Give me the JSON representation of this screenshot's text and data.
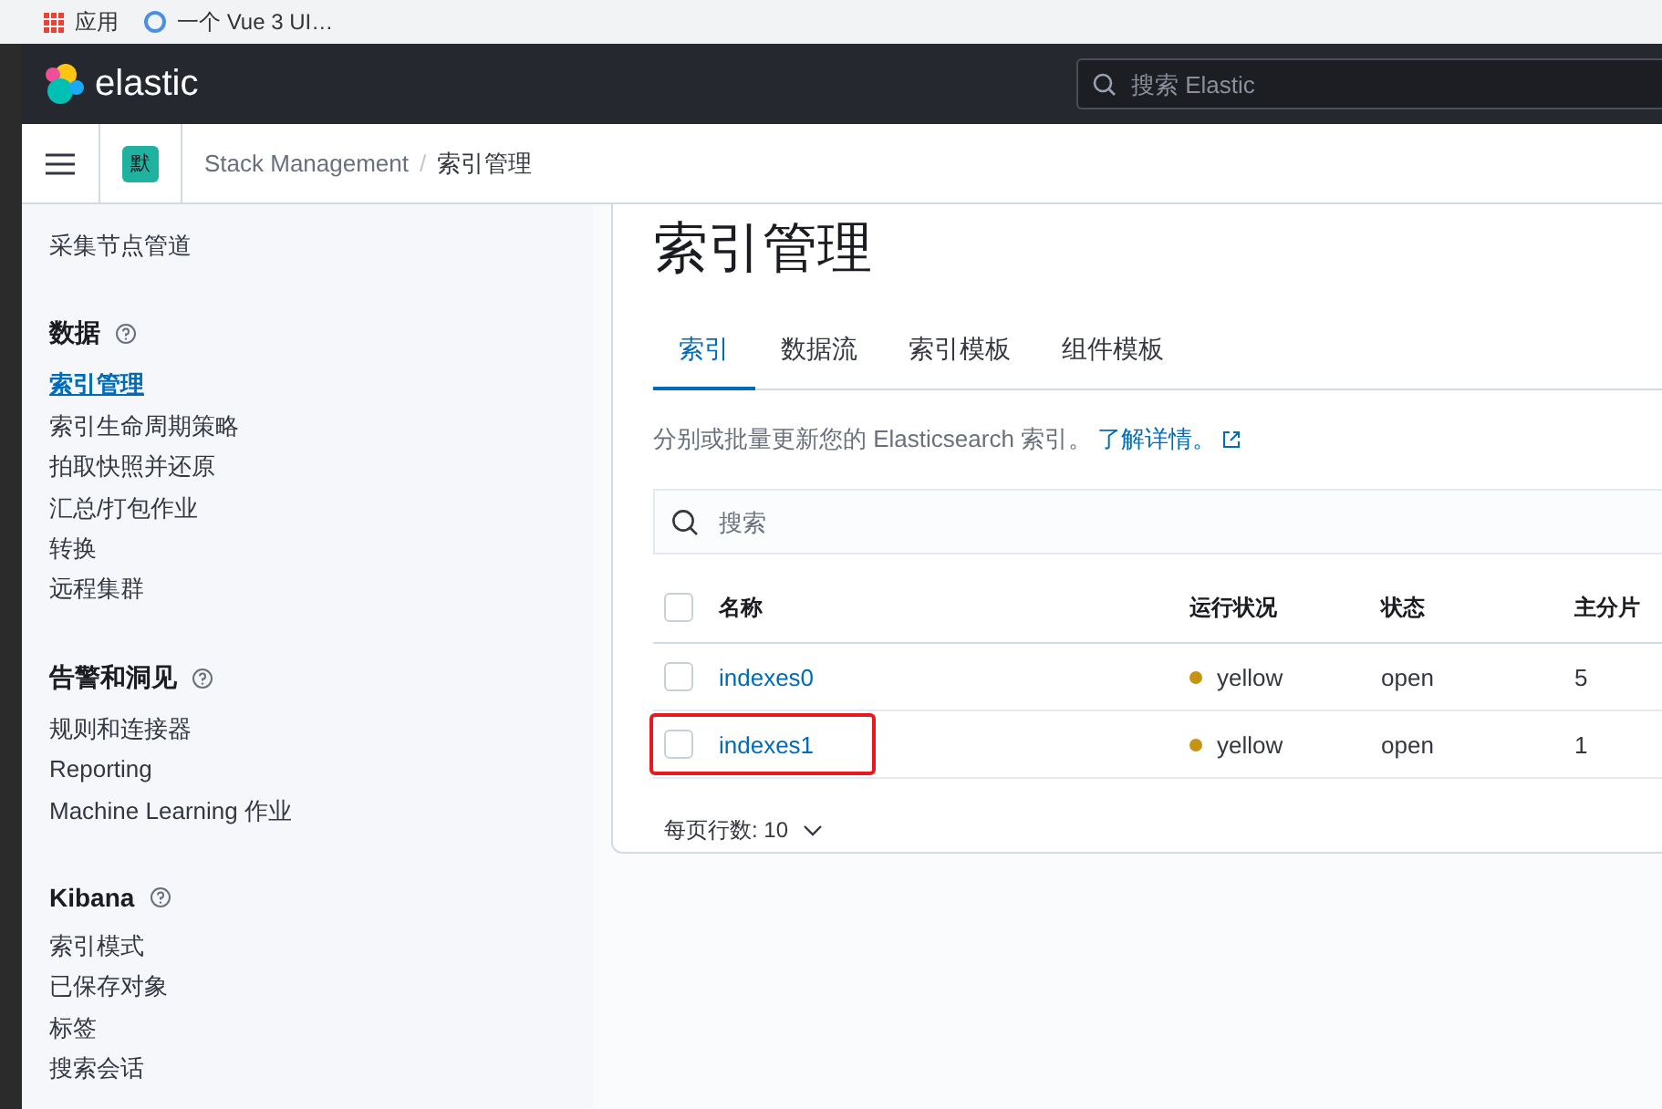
{
  "bookmarks": [
    {
      "kind": "apps",
      "label": "应用"
    },
    {
      "kind": "site",
      "label": "一个 Vue 3 UI…"
    }
  ],
  "header": {
    "logo_text": "elastic",
    "search": {
      "placeholder": "搜索 Elastic"
    }
  },
  "breadcrumb_bar": {
    "space_badge": "默",
    "crumbs": [
      "Stack Management",
      "索引管理"
    ],
    "separator": "/"
  },
  "sidebar": {
    "sections": [
      {
        "items": [
          {
            "label": "采集节点管道",
            "selected": false
          }
        ]
      },
      {
        "title": "数据",
        "items": [
          {
            "label": "索引管理",
            "selected": true
          },
          {
            "label": "索引生命周期策略",
            "selected": false
          },
          {
            "label": "拍取快照并还原",
            "selected": false
          },
          {
            "label": "汇总/打包作业",
            "selected": false
          },
          {
            "label": "转换",
            "selected": false
          },
          {
            "label": "远程集群",
            "selected": false
          }
        ]
      },
      {
        "title": "告警和洞见",
        "items": [
          {
            "label": "规则和连接器",
            "selected": false
          },
          {
            "label": "Reporting",
            "selected": false
          },
          {
            "label": "Machine Learning 作业",
            "selected": false
          }
        ]
      },
      {
        "title": "Kibana",
        "items": [
          {
            "label": "索引模式",
            "selected": false
          },
          {
            "label": "已保存对象",
            "selected": false
          },
          {
            "label": "标签",
            "selected": false
          },
          {
            "label": "搜索会话",
            "selected": false
          }
        ]
      }
    ]
  },
  "page": {
    "title": "索引管理",
    "tabs": [
      {
        "label": "索引",
        "selected": true
      },
      {
        "label": "数据流",
        "selected": false
      },
      {
        "label": "索引模板",
        "selected": false
      },
      {
        "label": "组件模板",
        "selected": false
      }
    ],
    "description": "分别或批量更新您的 Elasticsearch 索引。",
    "learn_more_link": "了解详情。",
    "search": {
      "placeholder": "搜索"
    },
    "table": {
      "select_all_checked": false,
      "columns": [
        "名称",
        "运行状况",
        "状态",
        "主分片"
      ],
      "rows": [
        {
          "checked": false,
          "highlighted": false,
          "name": "indexes0",
          "health": "yellow",
          "color": "#c59412",
          "status": "open",
          "primary_shards": "5"
        },
        {
          "checked": false,
          "highlighted": true,
          "name": "indexes1",
          "health": "yellow",
          "color": "#c59412",
          "status": "open",
          "primary_shards": "1"
        }
      ]
    },
    "rows_per_page": "每页行数: 10"
  }
}
